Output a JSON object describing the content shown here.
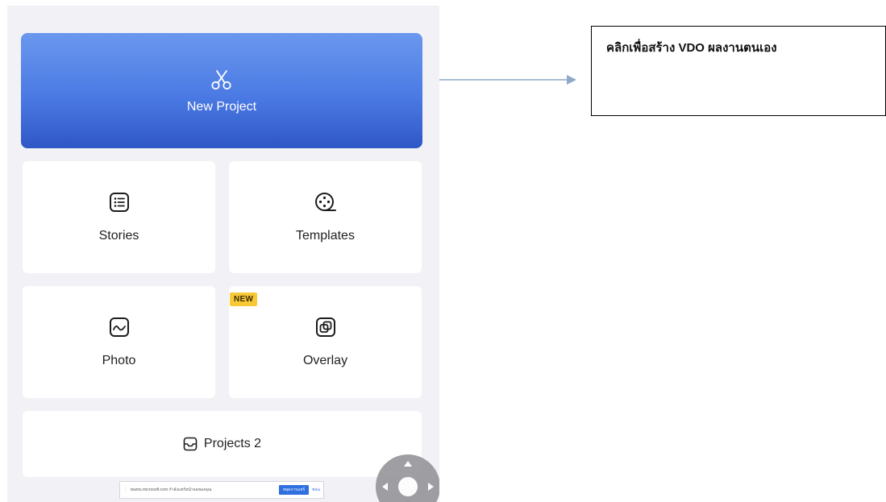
{
  "app": {
    "new_project_label": "New Project",
    "tiles": {
      "stories": "Stories",
      "templates": "Templates",
      "photo": "Photo",
      "overlay": "Overlay"
    },
    "new_badge": "NEW",
    "projects_label": "Projects 2",
    "icons": {
      "new_project": "scissors-icon",
      "stories": "list-icon",
      "templates": "film-reel-icon",
      "photo": "photo-icon",
      "overlay": "overlay-icon",
      "projects": "inbox-tray-icon",
      "joystick": "joystick-icon"
    }
  },
  "banner": {
    "text": "teams.microsoft.com กำลังแชร์หน้าจอของคุณ",
    "primary_button": "หยุดการแชร์",
    "secondary_button": "ซ่อน"
  },
  "callout": {
    "text": "คลิกเพื่อสร้าง VDO ผลงานตนเอง"
  },
  "colors": {
    "accent_gradient_top": "#6a98ee",
    "accent_gradient_bottom": "#2f57c6",
    "badge": "#f7c937",
    "background": "#f2f1f6",
    "arrow": "#8fa9c8"
  }
}
